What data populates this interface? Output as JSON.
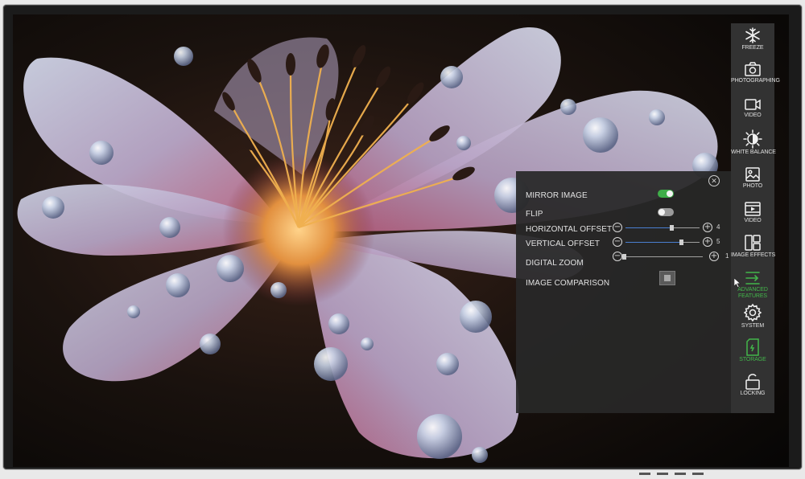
{
  "panel": {
    "close_icon": "close-circle-icon",
    "rows": [
      {
        "label": "MIRROR IMAGE",
        "toggle": "on"
      },
      {
        "label": "FLIP",
        "toggle": "off"
      },
      {
        "label": "HORIZONTAL OFFSET",
        "value": "4",
        "level": 0.62
      },
      {
        "label": "VERTICAL OFFSET",
        "value": "5",
        "level": 0.75
      },
      {
        "label": "DIGITAL ZOOM",
        "value": "1",
        "level": 0.0
      },
      {
        "label": "IMAGE COMPARISON"
      }
    ]
  },
  "sidebar": {
    "items": [
      {
        "label": "FREEZE",
        "icon": "snowflake-icon"
      },
      {
        "label": "PHOTOGRAPHING",
        "icon": "camera-icon"
      },
      {
        "label": "VIDEO",
        "icon": "video-camera-icon"
      },
      {
        "label": "WHITE BALANCE",
        "icon": "white-balance-icon"
      },
      {
        "label": "PHOTO",
        "icon": "photo-gallery-icon"
      },
      {
        "label": "VIDEO",
        "icon": "video-gallery-icon"
      },
      {
        "label": "IMAGE EFFECTS",
        "icon": "image-effects-icon"
      },
      {
        "label": "ADVANCED FEATURES",
        "icon": "advanced-features-icon"
      },
      {
        "label": "SYSTEM",
        "icon": "gear-icon"
      },
      {
        "label": "STORAGE",
        "icon": "storage-icon"
      },
      {
        "label": "LOCKING",
        "icon": "lock-icon"
      }
    ]
  },
  "colors": {
    "accent_green": "#43b64b",
    "toggle_on": "#3fae49",
    "slider_fill": "#4a7fd1",
    "panel_bg": "#282828"
  }
}
